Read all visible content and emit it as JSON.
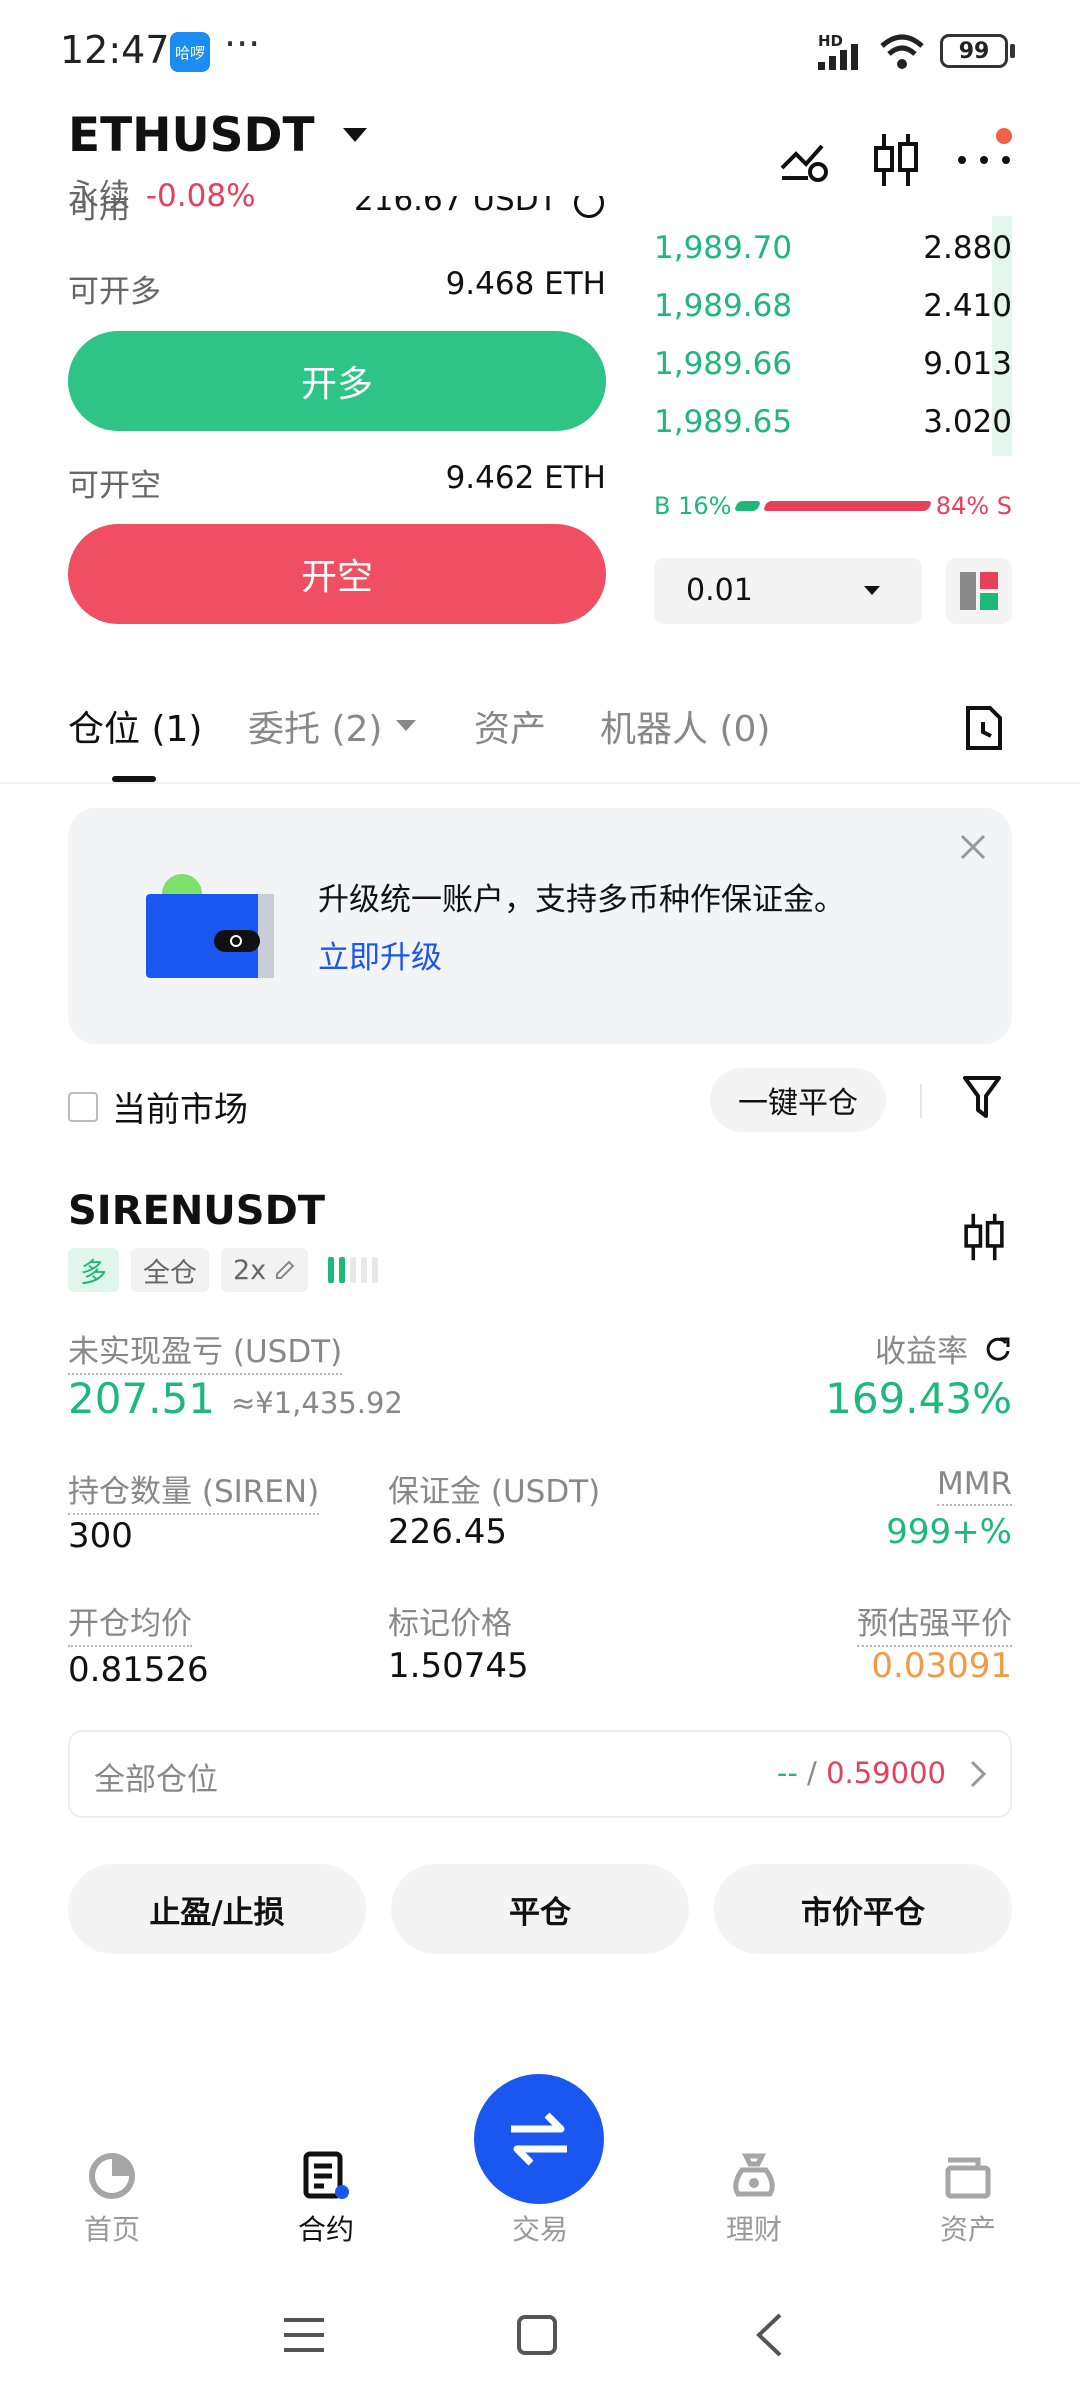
{
  "status_bar": {
    "time": "12:47",
    "app_badge": "哈啰",
    "more": "···",
    "network": "HD",
    "battery": "99"
  },
  "header": {
    "symbol": "ETHUSDT",
    "type_label": "永续",
    "change": "-0.08%"
  },
  "order_panel": {
    "available_label": "可用",
    "available_value": "216.67 USDT",
    "long_label": "可开多",
    "long_value": "9.468 ETH",
    "long_button": "开多",
    "short_label": "可开空",
    "short_value": "9.462 ETH",
    "short_button": "开空"
  },
  "order_book": {
    "bids": [
      {
        "price": "1,989.70",
        "qty": "2.880"
      },
      {
        "price": "1,989.68",
        "qty": "2.410"
      },
      {
        "price": "1,989.66",
        "qty": "9.013"
      },
      {
        "price": "1,989.65",
        "qty": "3.020"
      }
    ],
    "ratio_buy": "B 16%",
    "ratio_sell": "84% S",
    "buy_fraction": 0.16,
    "precision": "0.01"
  },
  "tabs": [
    {
      "label": "仓位 (1)"
    },
    {
      "label": "委托 (2)"
    },
    {
      "label": "资产"
    },
    {
      "label": "机器人 (0)"
    }
  ],
  "banner": {
    "text": "升级统一账户，支持多币种作保证金。",
    "link": "立即升级"
  },
  "filter": {
    "current_market": "当前市场",
    "close_all": "一键平仓"
  },
  "position": {
    "symbol": "SIRENUSDT",
    "tag_side": "多",
    "tag_margin": "全仓",
    "tag_leverage": "2x",
    "upnl_label": "未实现盈亏 (USDT)",
    "upnl_value": "207.51",
    "upnl_cny": "≈¥1,435.92",
    "roe_label": "收益率",
    "roe_value": "169.43%",
    "size_label": "持仓数量 (SIREN)",
    "size_value": "300",
    "margin_label": "保证金 (USDT)",
    "margin_value": "226.45",
    "mmr_label": "MMR",
    "mmr_value": "999+%",
    "entry_label": "开仓均价",
    "entry_value": "0.81526",
    "mark_label": "标记价格",
    "mark_value": "1.50745",
    "liq_label": "预估强平价",
    "liq_value": "0.03091",
    "all_positions_label": "全部仓位",
    "all_positions_tp": "--",
    "all_positions_sep": " / ",
    "all_positions_sl": "0.59000",
    "btn_tpsl": "止盈/止损",
    "btn_close": "平仓",
    "btn_market_close": "市价平仓"
  },
  "bottom_nav": [
    {
      "label": "首页"
    },
    {
      "label": "合约"
    },
    {
      "label": "交易"
    },
    {
      "label": "理财"
    },
    {
      "label": "资产"
    }
  ],
  "colors": {
    "green": "#1eb87a",
    "red": "#e8405a",
    "blue": "#1a56f0",
    "orange": "#f29b46"
  }
}
